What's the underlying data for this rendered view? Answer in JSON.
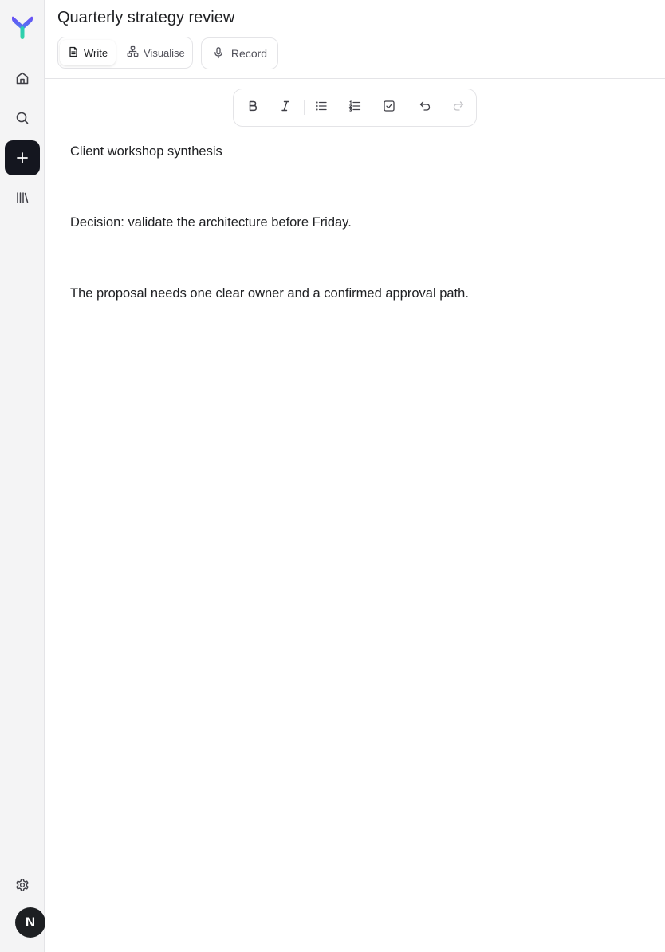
{
  "document": {
    "title": "Quarterly strategy review"
  },
  "modes": {
    "tabs": [
      {
        "label": "Write",
        "icon": "document-icon",
        "active": true
      },
      {
        "label": "Visualise",
        "icon": "diagram-icon",
        "active": false
      }
    ],
    "record_label": "Record",
    "record_icon": "microphone-icon"
  },
  "sidebar": {
    "items": [
      {
        "icon": "home-icon"
      },
      {
        "icon": "search-icon"
      },
      {
        "icon": "plus-icon"
      },
      {
        "icon": "library-icon"
      }
    ],
    "settings_icon": "gear-icon",
    "avatar_initial": "N"
  },
  "toolbar": {
    "buttons": [
      "bold-icon",
      "italic-icon",
      "bullet-list-icon",
      "numbered-list-icon",
      "checklist-icon",
      "undo-icon",
      "redo-icon"
    ]
  },
  "editor": {
    "paragraphs": [
      "Client workshop synthesis",
      "Decision: validate the architecture before Friday.",
      "The proposal needs one clear owner and a confirmed approval path."
    ]
  },
  "colors": {
    "sidebar_bg": "#f4f4f5",
    "new_button_bg": "#14161f",
    "logo_purple": "#6b4cf6",
    "logo_teal": "#27c9b5",
    "text": "#1f2023",
    "muted": "#52525b",
    "border": "#e4e4e7"
  }
}
